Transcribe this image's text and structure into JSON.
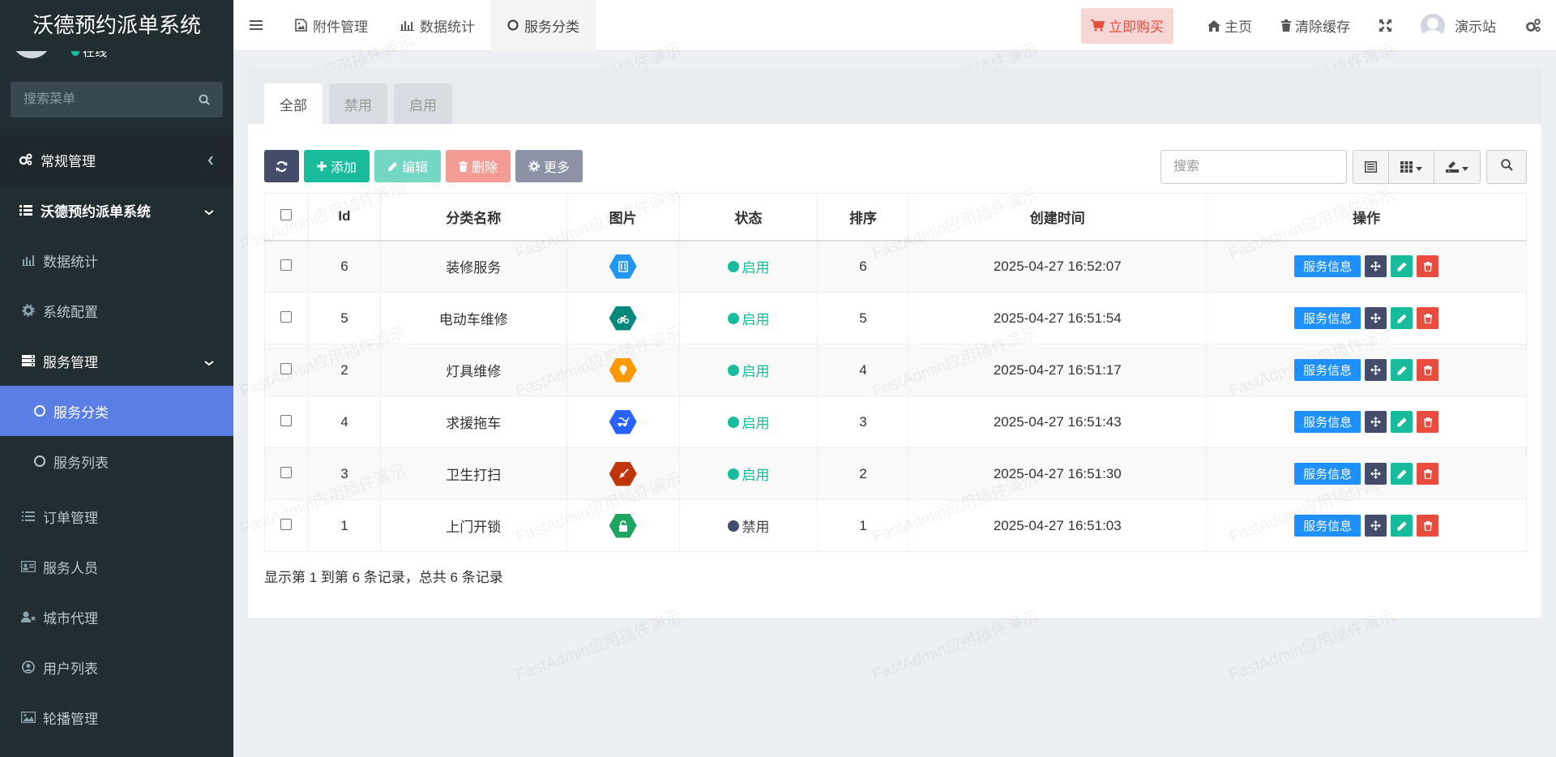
{
  "sidebar": {
    "title": "沃德预约派单系统",
    "status": "在线",
    "search_placeholder": "搜索菜单",
    "menu": [
      {
        "label": "常规管理"
      },
      {
        "label": "沃德预约派单系统"
      },
      {
        "label": "数据统计"
      },
      {
        "label": "系统配置"
      },
      {
        "label": "服务管理"
      },
      {
        "label": "服务分类"
      },
      {
        "label": "服务列表"
      },
      {
        "label": "订单管理"
      },
      {
        "label": "服务人员"
      },
      {
        "label": "城市代理"
      },
      {
        "label": "用户列表"
      },
      {
        "label": "轮播管理"
      }
    ]
  },
  "navbar": {
    "tabs": [
      {
        "label": "附件管理"
      },
      {
        "label": "数据统计"
      },
      {
        "label": "服务分类"
      }
    ],
    "buy_label": "立即购买",
    "home_label": "主页",
    "clear_cache_label": "清除缓存",
    "user_label": "演示站"
  },
  "filter_tabs": [
    "全部",
    "禁用",
    "启用"
  ],
  "toolbar": {
    "add_label": "添加",
    "edit_label": "编辑",
    "delete_label": "删除",
    "more_label": "更多",
    "search_placeholder": "搜索"
  },
  "table": {
    "columns": [
      "Id",
      "分类名称",
      "图片",
      "状态",
      "排序",
      "创建时间",
      "操作"
    ],
    "rows": [
      {
        "id": "6",
        "name": "装修服务",
        "icon_color": "#2196f3",
        "icon": "building-icon",
        "status": "启用",
        "sort": "6",
        "created": "2025-04-27 16:52:07"
      },
      {
        "id": "5",
        "name": "电动车维修",
        "icon_color": "#00897b",
        "icon": "scooter-icon",
        "status": "启用",
        "sort": "5",
        "created": "2025-04-27 16:51:54"
      },
      {
        "id": "2",
        "name": "灯具维修",
        "icon_color": "#ff9800",
        "icon": "bulb-icon",
        "status": "启用",
        "sort": "4",
        "created": "2025-04-27 16:51:17"
      },
      {
        "id": "4",
        "name": "求援拖车",
        "icon_color": "#2962ff",
        "icon": "tow-truck-icon",
        "status": "启用",
        "sort": "3",
        "created": "2025-04-27 16:51:43"
      },
      {
        "id": "3",
        "name": "卫生打扫",
        "icon_color": "#bf360c",
        "icon": "broom-icon",
        "status": "启用",
        "sort": "2",
        "created": "2025-04-27 16:51:30"
      },
      {
        "id": "1",
        "name": "上门开锁",
        "icon_color": "#1fa463",
        "icon": "lock-icon",
        "status": "禁用",
        "sort": "1",
        "created": "2025-04-27 16:51:03"
      }
    ],
    "op_info_label": "服务信息"
  },
  "pagination_info": "显示第 1 到第 6 条记录，总共 6 条记录",
  "watermark": "FastAdmin应用插件演示"
}
